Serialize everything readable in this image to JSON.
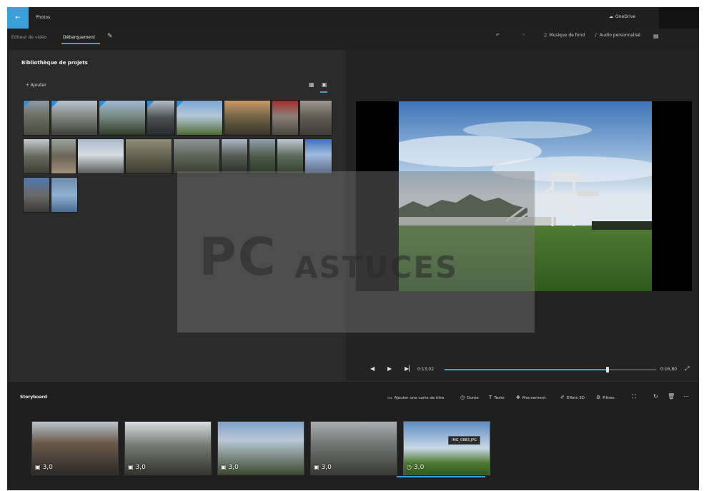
{
  "app": {
    "title": "Photos",
    "back_icon": "back-arrow-icon",
    "onedrive_label": "OneDrive"
  },
  "tabs": [
    {
      "label": "Éditeur de vidéo",
      "active": false
    },
    {
      "label": "Débarquement",
      "active": true
    }
  ],
  "top_toolbar": {
    "undo_icon": "undo-icon",
    "redo_icon": "redo-icon",
    "background_music_label": "Musique de fond",
    "custom_audio_label": "Audio personnalisé",
    "more_icon": "more-icon"
  },
  "library": {
    "title": "Bibliothèque de projets",
    "add_label": "+ Ajouter",
    "grid_view_icon": "grid-view-icon",
    "list_view_icon": "list-view-icon"
  },
  "player": {
    "current_time": "0:13,02",
    "end_time": "0:16,80",
    "progress": 0.77
  },
  "storyboard": {
    "title": "Storyboard",
    "tools": [
      {
        "label": "Ajouter une carte de titre",
        "icon": "title-card-icon"
      },
      {
        "label": "Durée",
        "icon": "clock-icon"
      },
      {
        "label": "Texte",
        "icon": "text-icon"
      },
      {
        "label": "Mouvement",
        "icon": "motion-icon"
      },
      {
        "label": "Effets 3D",
        "icon": "effects-3d-icon"
      },
      {
        "label": "Filtres",
        "icon": "filters-icon"
      }
    ],
    "clips": [
      {
        "duration": "3,0",
        "icon": "photo-icon"
      },
      {
        "duration": "3,0",
        "icon": "photo-icon"
      },
      {
        "duration": "3,0",
        "icon": "photo-icon"
      },
      {
        "duration": "3,0",
        "icon": "photo-icon"
      },
      {
        "duration": "3,0",
        "icon": "clock-icon",
        "selected": true,
        "tooltip": "IMG_0883.JPG"
      }
    ]
  },
  "watermark": {
    "text_main": "PC",
    "text_sub": "ASTUCES"
  }
}
